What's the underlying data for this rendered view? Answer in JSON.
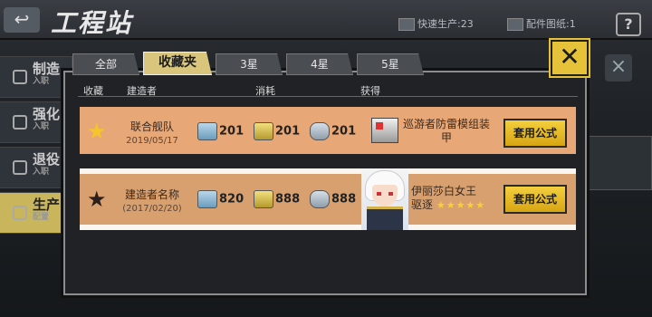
{
  "header": {
    "title": "工程站",
    "back_icon": "back-arrow-icon",
    "help_label": "?"
  },
  "resources": [
    {
      "icon": "fast-build-icon",
      "label": "快速生产:23"
    },
    {
      "icon": "blueprint-icon",
      "label": "配件图纸:1"
    }
  ],
  "side_menu": [
    {
      "label": "制造",
      "sub": "入职"
    },
    {
      "label": "强化",
      "sub": "入职"
    },
    {
      "label": "退役",
      "sub": "入职"
    },
    {
      "label": "生产",
      "sub": "配置"
    }
  ],
  "tabs": [
    "全部",
    "收藏夹",
    "3星",
    "4星",
    "5星"
  ],
  "active_tab": "收藏夹",
  "columns": {
    "fav": "收藏",
    "builder": "建造者",
    "cost": "消耗",
    "result": "获得"
  },
  "rows": [
    {
      "starred": true,
      "builder": "联合舰队",
      "date": "2019/05/17",
      "costs": [
        "201",
        "201",
        "201"
      ],
      "result": "巡游者防雷模组装甲",
      "apply": "套用公式"
    },
    {
      "starred": false,
      "builder": "建造者名称",
      "date": "(2017/02/20)",
      "costs": [
        "820",
        "888",
        "888"
      ],
      "result": "伊丽莎白女王",
      "result_sub": "驱逐",
      "result_stars": "★★★★★",
      "apply": "套用公式"
    }
  ],
  "colors": {
    "accent": "#e6c13a",
    "row": "#e8a776",
    "panel": "#202225"
  }
}
